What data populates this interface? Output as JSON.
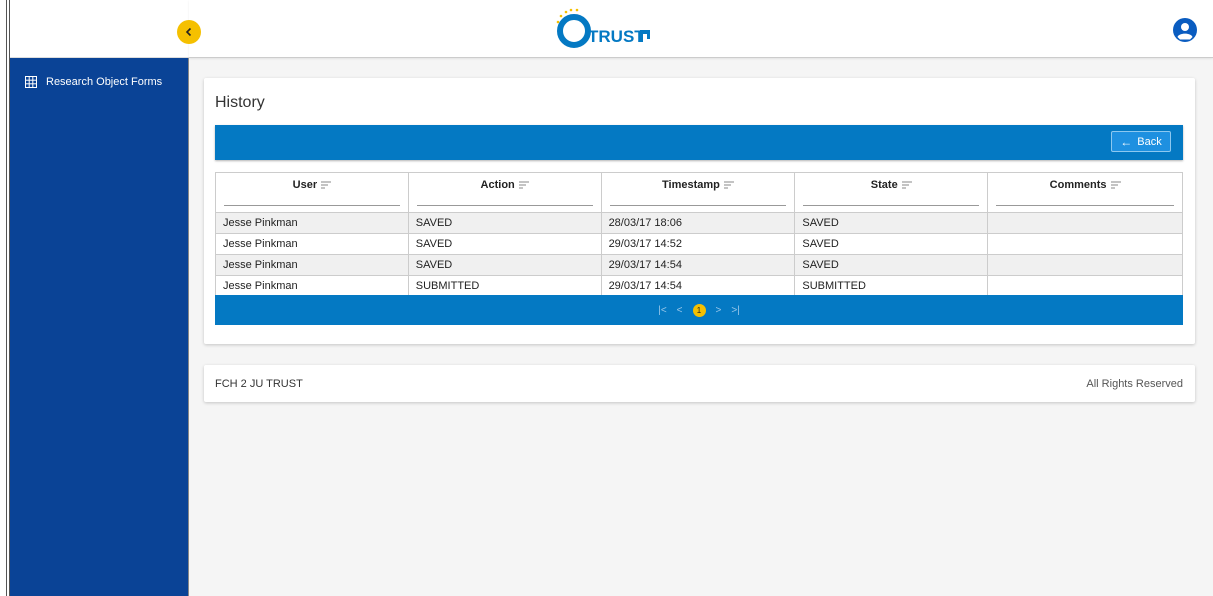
{
  "sidebar": {
    "items": [
      {
        "label": "Research Object Forms"
      }
    ]
  },
  "header": {
    "logo_text": "TRUST"
  },
  "history": {
    "title": "History",
    "back_label": "Back",
    "columns": [
      "User",
      "Action",
      "Timestamp",
      "State",
      "Comments"
    ],
    "rows": [
      [
        "Jesse Pinkman",
        "SAVED",
        "28/03/17 18:06",
        "SAVED",
        ""
      ],
      [
        "Jesse Pinkman",
        "SAVED",
        "29/03/17 14:52",
        "SAVED",
        ""
      ],
      [
        "Jesse Pinkman",
        "SAVED",
        "29/03/17 14:54",
        "SAVED",
        ""
      ],
      [
        "Jesse Pinkman",
        "SUBMITTED",
        "29/03/17 14:54",
        "SUBMITTED",
        ""
      ]
    ],
    "pager": {
      "first": "|<",
      "prev": "<",
      "current": "1",
      "next": ">",
      "last": ">|"
    }
  },
  "footer": {
    "left": "FCH 2 JU TRUST",
    "right": "All Rights Reserved"
  },
  "colors": {
    "sidebar": "#0a4396",
    "primary_bar": "#0479c3",
    "accent": "#f5c000"
  }
}
